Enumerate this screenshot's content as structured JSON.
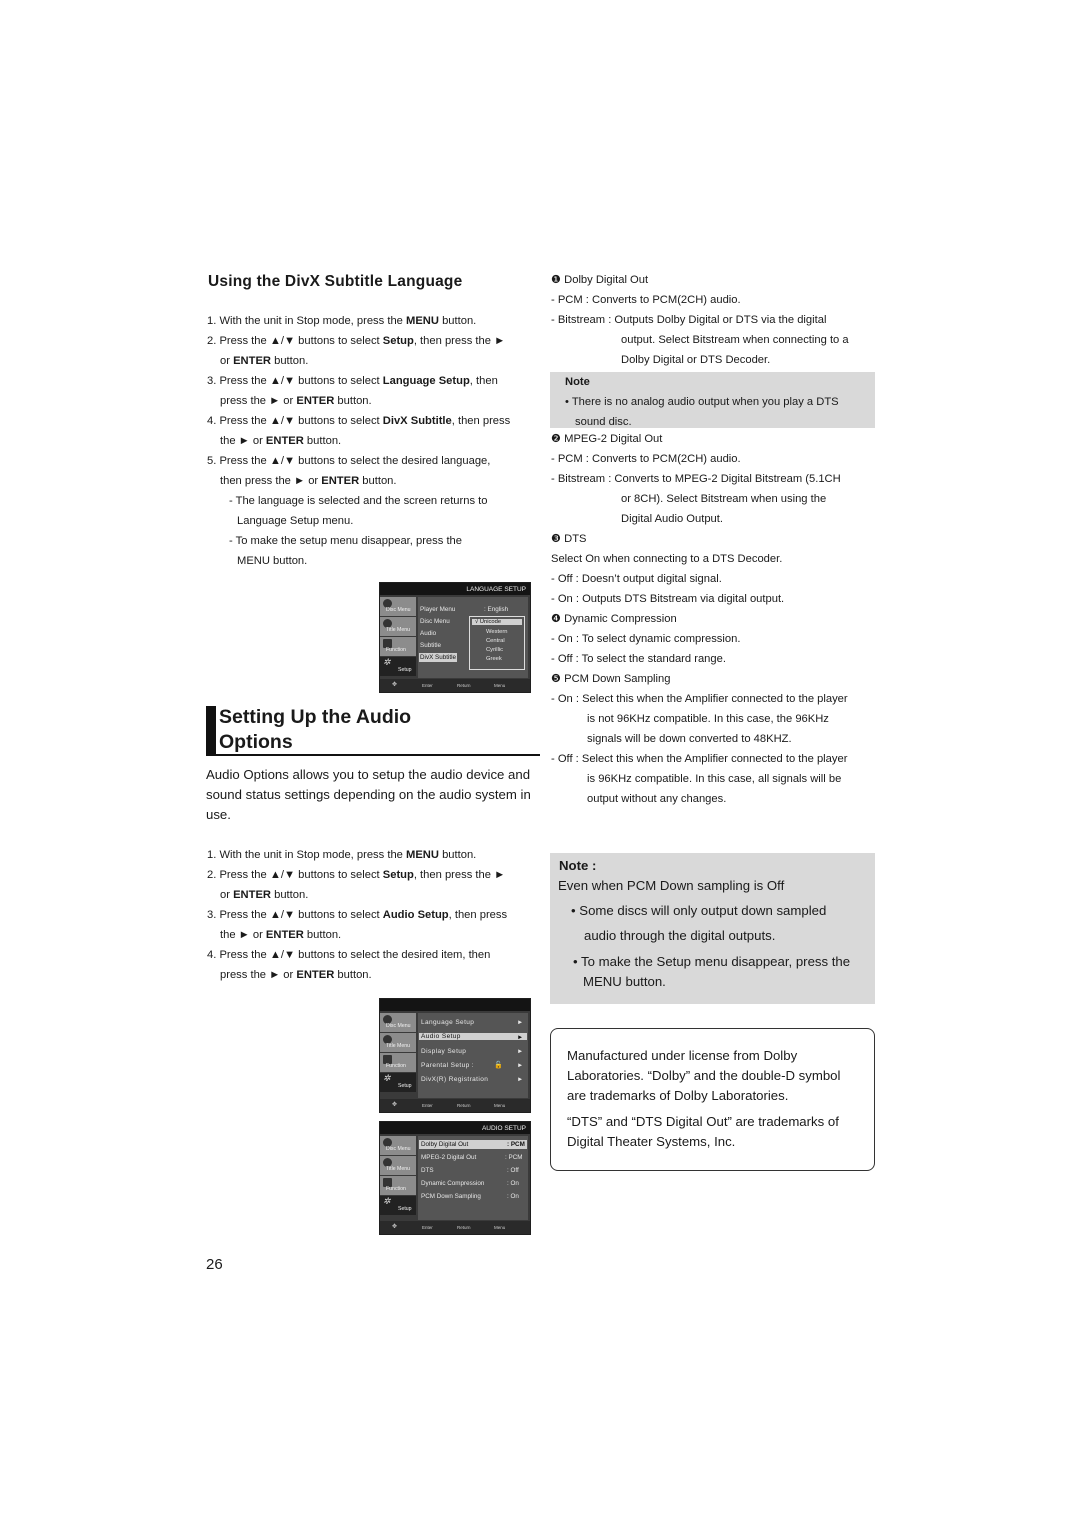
{
  "page_number": "26",
  "subtitle_section": {
    "heading": "Using the DivX Subtitle Language",
    "steps": [
      {
        "num": "1.",
        "parts": [
          [
            "With the unit in Stop mode, press the ",
            0
          ],
          [
            "MENU",
            1
          ],
          [
            " button.",
            0
          ]
        ]
      },
      {
        "num": "2.",
        "parts": [
          [
            "Press the ▲/▼ buttons to select ",
            0
          ],
          [
            "Setup",
            1
          ],
          [
            ", then press the ►",
            0
          ]
        ],
        "cont": [
          [
            "or ",
            0
          ],
          [
            "ENTER",
            1
          ],
          [
            " button.",
            0
          ]
        ]
      },
      {
        "num": "3.",
        "parts": [
          [
            "Press the ▲/▼ buttons to select ",
            0
          ],
          [
            "Language Setup",
            1
          ],
          [
            ", then",
            0
          ]
        ],
        "cont": [
          [
            "press the ► or ",
            0
          ],
          [
            "ENTER",
            1
          ],
          [
            " button.",
            0
          ]
        ]
      },
      {
        "num": "4.",
        "parts": [
          [
            "Press the ▲/▼ buttons to select ",
            0
          ],
          [
            "DivX Subtitle",
            1
          ],
          [
            ", then press",
            0
          ]
        ],
        "cont": [
          [
            "the ►  or ",
            0
          ],
          [
            "ENTER",
            1
          ],
          [
            " button.",
            0
          ]
        ]
      },
      {
        "num": "5.",
        "parts": [
          [
            "Press the ▲/▼ buttons to select the desired  language,",
            0
          ]
        ],
        "cont": [
          [
            "then press the ► or ",
            0
          ],
          [
            "ENTER",
            1
          ],
          [
            " button.",
            0
          ]
        ]
      }
    ],
    "sub_notes": [
      [
        "- The language is selected and the screen returns to",
        "Language Setup menu."
      ],
      [
        "- To make the setup menu disappear, press the",
        "MENU button."
      ]
    ]
  },
  "osd_language": {
    "header": "LANGUAGE SETUP",
    "sidebar": [
      "Disc Menu",
      "Title Menu",
      "Function",
      "Setup"
    ],
    "items": [
      "Player Menu",
      "Disc Menu",
      "Audio",
      "Subtitle",
      "DivX Subtitle"
    ],
    "player_menu_value": ": English",
    "options": [
      "√  Unicode",
      "Western",
      "Central",
      "Cyrillic",
      "Greek"
    ],
    "footer": [
      "Enter",
      "Return",
      "Menu"
    ]
  },
  "audio_section": {
    "title_line1": "Setting Up the Audio",
    "title_line2": "Options",
    "intro": "Audio Options allows you to setup the audio device and sound status settings depending on the audio system in use.",
    "steps": [
      {
        "num": "1.",
        "parts": [
          [
            "With the unit in Stop mode, press the ",
            0
          ],
          [
            "MENU",
            1
          ],
          [
            " button.",
            0
          ]
        ]
      },
      {
        "num": "2.",
        "parts": [
          [
            "Press the ▲/▼ buttons to select ",
            0
          ],
          [
            "Setup",
            1
          ],
          [
            ", then press the ►",
            0
          ]
        ],
        "cont": [
          [
            "or ",
            0
          ],
          [
            "ENTER",
            1
          ],
          [
            " button.",
            0
          ]
        ]
      },
      {
        "num": "3.",
        "parts": [
          [
            "Press the ▲/▼ buttons to select ",
            0
          ],
          [
            "Audio Setup",
            1
          ],
          [
            ", then press",
            0
          ]
        ],
        "cont": [
          [
            "the ► or ",
            0
          ],
          [
            "ENTER",
            1
          ],
          [
            " button.",
            0
          ]
        ]
      },
      {
        "num": "4.",
        "parts": [
          [
            "Press the ▲/▼ buttons to select the desired item, then",
            0
          ]
        ],
        "cont": [
          [
            "press the ► or ",
            0
          ],
          [
            "ENTER",
            1
          ],
          [
            " button.",
            0
          ]
        ]
      }
    ]
  },
  "osd_setup": {
    "sidebar": [
      "Disc Menu",
      "Title Menu",
      "Function",
      "Setup"
    ],
    "items": [
      "Language Setup",
      "Audio Setup",
      "Display Setup",
      "Parental Setup :",
      "DivX(R) Registration"
    ],
    "arrow": "►",
    "footer": [
      "Enter",
      "Return",
      "Menu"
    ]
  },
  "osd_audio": {
    "header": "AUDIO SETUP",
    "sidebar": [
      "Disc Menu",
      "Title Menu",
      "Function",
      "Setup"
    ],
    "items": [
      {
        "label": "Dolby Digital Out",
        "value": ": PCM"
      },
      {
        "label": "MPEG-2 Digital Out",
        "value": ":  PCM"
      },
      {
        "label": "DTS",
        "value": ": Off"
      },
      {
        "label": "Dynamic Compression",
        "value": ": On"
      },
      {
        "label": "PCM Down Sampling",
        "value": ": On"
      }
    ],
    "footer": [
      "Enter",
      "Return",
      "Menu"
    ]
  },
  "right_column": {
    "dolby": {
      "heading": "❶ Dolby Digital Out",
      "pcm": "- PCM : Converts to PCM(2CH) audio.",
      "bitstream": [
        "- Bitstream : Outputs Dolby Digital or DTS via the digital",
        "output. Select Bitstream when connecting to a",
        "Dolby Digital or DTS Decoder."
      ]
    },
    "note_small": {
      "title": "Note",
      "lines": [
        "• There is no analog audio output when you play a DTS",
        "sound disc."
      ]
    },
    "mpeg": {
      "heading": "❷ MPEG-2 Digital Out",
      "pcm": "- PCM : Converts to PCM(2CH) audio.",
      "bitstream": [
        "- Bitstream : Converts to MPEG-2 Digital Bitstream (5.1CH",
        "or 8CH). Select Bitstream when using the",
        "Digital Audio Output."
      ]
    },
    "dts": {
      "heading": "❸ DTS",
      "lines": [
        "Select On when connecting to a DTS Decoder.",
        "- Off : Doesn’t output digital signal.",
        "- On : Outputs DTS Bitstream via digital output."
      ]
    },
    "dyn": {
      "heading": "❹ Dynamic Compression",
      "lines": [
        "- On : To select dynamic compression.",
        "- Off : To select the standard range."
      ]
    },
    "pcmds": {
      "heading": "❺ PCM Down Sampling",
      "on": [
        "- On : Select this when the Amplifier connected to the player",
        "is not 96KHz compatible. In this case, the 96KHz",
        "signals will be down converted to 48KHZ."
      ],
      "off": [
        "- Off : Select this when the Amplifier connected to the player",
        "is 96KHz compatible. In this case, all signals will be",
        "output without any changes."
      ]
    },
    "note_big": {
      "title": "Note :",
      "line": "Even when PCM Down sampling is Off",
      "b1": [
        "• Some discs will only output down sampled",
        "audio through the digital outputs."
      ],
      "b2": [
        "• To make the Setup menu disappear, press the",
        "MENU button."
      ]
    },
    "trademark": {
      "p1": [
        "Manufactured under license from Dolby",
        "Laboratories. “Dolby” and the double-D symbol",
        "are trademarks of Dolby Laboratories."
      ],
      "p2": [
        "“DTS” and “DTS Digital Out” are trademarks of",
        "Digital Theater Systems, Inc."
      ]
    }
  }
}
